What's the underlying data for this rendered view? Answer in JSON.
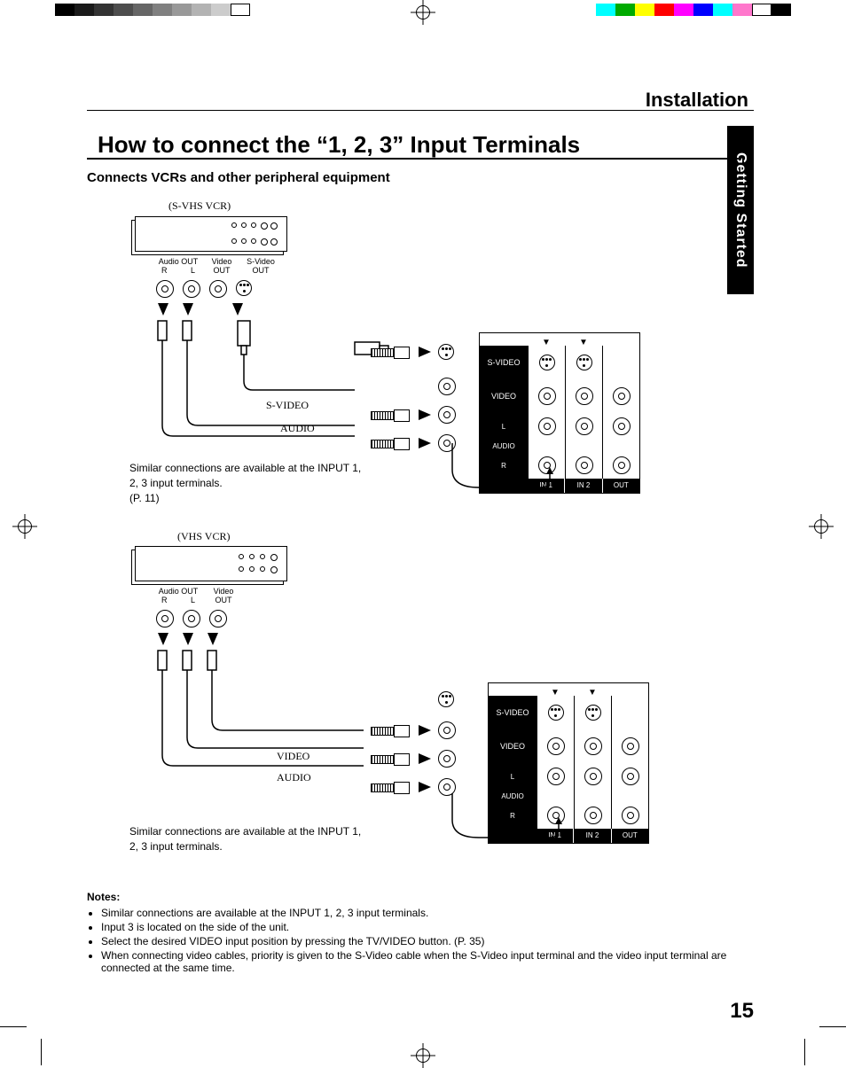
{
  "section": "Installation",
  "side_tab": "Getting Started",
  "heading": "How to connect the “1, 2, 3” Input Terminals",
  "subheading": "Connects VCRs and other peripheral equipment",
  "diagram1": {
    "device_label": "(S-VHS VCR)",
    "out_labels": {
      "audio": "Audio OUT",
      "audio_r": "R",
      "audio_l": "L",
      "video": "Video OUT",
      "svideo": "S-Video OUT"
    },
    "cable_labels": {
      "svideo": "S-VIDEO",
      "audio": "AUDIO"
    },
    "caption": "Similar connections are available at the INPUT 1, 2, 3 input terminals.",
    "caption_ref": "(P. 11)"
  },
  "diagram2": {
    "device_label": "(VHS VCR)",
    "out_labels": {
      "audio": "Audio OUT",
      "audio_r": "R",
      "audio_l": "L",
      "video": "Video OUT"
    },
    "cable_labels": {
      "video": "VIDEO",
      "audio": "AUDIO"
    },
    "caption": "Similar connections are available at the INPUT 1, 2, 3 input terminals."
  },
  "panel": {
    "rows": [
      "S-VIDEO",
      "VIDEO",
      "L",
      "AUDIO",
      "R"
    ],
    "footer": [
      "IN 1",
      "IN 2",
      "OUT"
    ]
  },
  "notes": {
    "title": "Notes:",
    "items": [
      "Similar connections are available at the INPUT 1, 2, 3 input terminals.",
      "Input 3 is located on the side of the unit.",
      "Select the desired VIDEO input position by pressing the TV/VIDEO button. (P. 35)",
      "When connecting video cables, priority is given to the S-Video cable when the S-Video input terminal and the video input terminal are connected at the same time."
    ]
  },
  "page_number": "15"
}
